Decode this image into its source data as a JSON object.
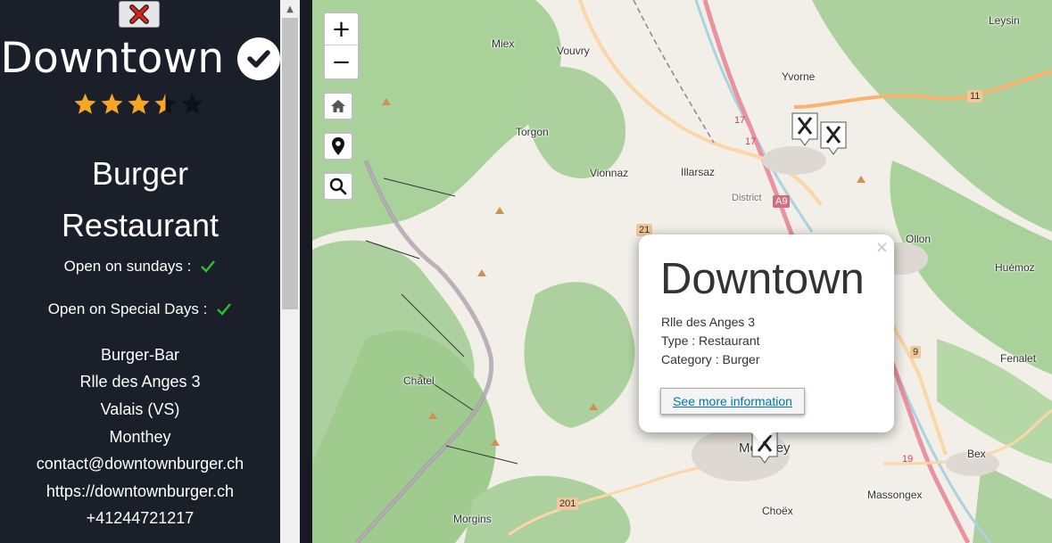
{
  "sidebar": {
    "title": "Downtown",
    "rating": 3.5,
    "rating_max": 5,
    "category_line1": "Burger",
    "category_line2": "Restaurant",
    "open_sundays_label": "Open on sundays :",
    "open_special_label": "Open on Special Days :",
    "type": "Burger-Bar",
    "address": "Rlle des Anges 3",
    "canton": "Valais (VS)",
    "city": "Monthey",
    "email": "contact@downtownburger.ch",
    "website": "https://downtownburger.ch",
    "phone": "+41244721217"
  },
  "map": {
    "zoom_in": "+",
    "zoom_out": "−",
    "labels": {
      "miex": "Miex",
      "vouvry": "Vouvry",
      "yvorne": "Yvorne",
      "leysin": "Leysin",
      "torgon": "Torgon",
      "vionnaz": "Vionnaz",
      "illarsaz": "Illarsaz",
      "ollon": "Ollon",
      "huemoz": "Huémoz",
      "fenalet": "Fenalet",
      "chatel": "Châtel",
      "bex": "Bex",
      "massongex": "Massongex",
      "choex": "Choëx",
      "morgins": "Morgins",
      "monthey": "Monthey",
      "district": "District"
    },
    "shields": {
      "a9": "A9",
      "r11": "11",
      "r21": "21",
      "r9": "9",
      "r201": "201",
      "r17a": "17",
      "r17b": "17",
      "r19": "19"
    }
  },
  "popup": {
    "title": "Downtown",
    "close": "×",
    "address": "Rlle des Anges 3",
    "type": "Type : Restaurant",
    "category": "Category : Burger",
    "more_button": "See more information"
  },
  "colors": {
    "sidebar_bg": "#1b1f2a",
    "star": "#f5a623",
    "check": "#2fbf2f",
    "link": "#0078a8"
  }
}
